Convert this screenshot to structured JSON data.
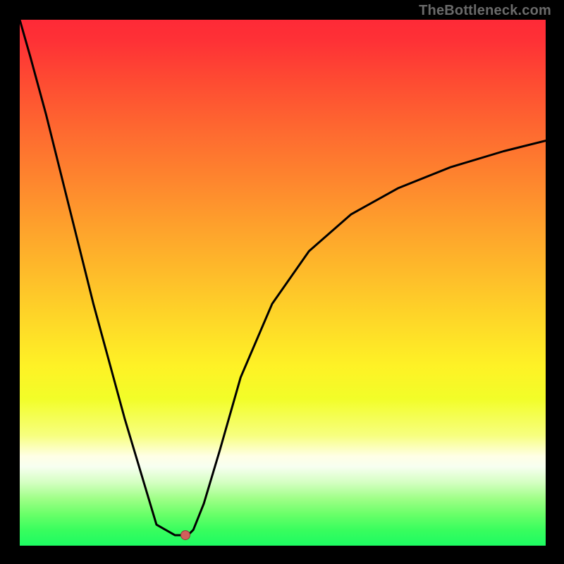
{
  "attribution": "TheBottleneck.com",
  "colors": {
    "bg": "#000000",
    "attribution_text": "#6a6a6a",
    "gradient_top": "#fe2a37",
    "gradient_bottom": "#1dfc62",
    "curve": "#000000",
    "marker_fill": "#d15f5b",
    "marker_stroke": "#8e3b3b"
  },
  "chart_data": {
    "type": "line",
    "title": "",
    "xlabel": "",
    "ylabel": "",
    "xlim": [
      0,
      100
    ],
    "ylim": [
      0,
      100
    ],
    "grid": false,
    "legend": false,
    "gradient_stops": [
      {
        "pos": 0.0,
        "color": "#fe2a37"
      },
      {
        "pos": 0.66,
        "color": "#fef226"
      },
      {
        "pos": 0.83,
        "color": "#ffffe6"
      },
      {
        "pos": 1.0,
        "color": "#1dfc62"
      }
    ],
    "series": [
      {
        "name": "bottleneck-curve",
        "x": [
          0.0,
          2.0,
          5.0,
          8.0,
          11.0,
          14.0,
          17.0,
          20.0,
          23.0,
          26.0,
          29.5,
          30.5,
          32.0,
          33.0,
          35.0,
          38.0,
          42.0,
          48.0,
          55.0,
          63.0,
          72.0,
          82.0,
          92.0,
          100.0
        ],
        "y": [
          100.0,
          93.0,
          82.0,
          70.0,
          58.0,
          46.0,
          35.0,
          24.0,
          14.0,
          4.0,
          2.0,
          2.0,
          2.0,
          3.0,
          8.0,
          18.0,
          32.0,
          46.0,
          56.0,
          63.0,
          68.0,
          72.0,
          75.0,
          77.0
        ]
      }
    ],
    "marker": {
      "x": 31.5,
      "y": 2.0
    }
  }
}
